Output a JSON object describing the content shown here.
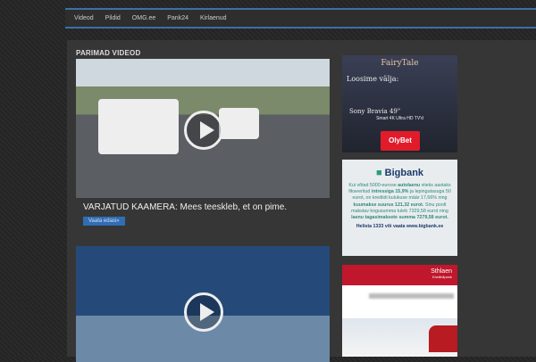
{
  "nav": {
    "items": [
      "Videod",
      "Pildid",
      "OMG.ee",
      "Pank24",
      "Kirlaenud"
    ]
  },
  "section": {
    "heading": "PARIMAD VIDEOD"
  },
  "videos": [
    {
      "title": "VARJATUD KAAMERA: Mees teeskleb, et on pime.",
      "button": "Vaata edasi»"
    }
  ],
  "ads": {
    "olybet": {
      "logo_text": "FairyTale",
      "line1": "Loosime välja:",
      "line2": "Sony Bravia 49\"",
      "line3": "Smart 4K Ultra HD TV'd",
      "brand": "OlyBet"
    },
    "bigbank": {
      "brand": "Bigbank",
      "text1": "Kui võtad 5000-eurose",
      "b1": "autolaenu",
      "text2": "viieks aastaks fikseeritud",
      "b2": "intressiga 15,9%",
      "text3": "ja lepingutasuga 50 eurot, on krediidi kulukuse määr 17,66% ning",
      "b3": "kuumakse suurus 121,32 eurot.",
      "text4": "Sinu poolt makstav kogusumma tuleb 7329,58 eurot ning",
      "b4": "laenu tagasimaksete summa 7279,58 eurot.",
      "footer": "Helista 1333 või vaata www.bigbank.ee"
    },
    "sthlaen": {
      "brand": "Sthlaen",
      "sub": "Krediidipank"
    }
  }
}
